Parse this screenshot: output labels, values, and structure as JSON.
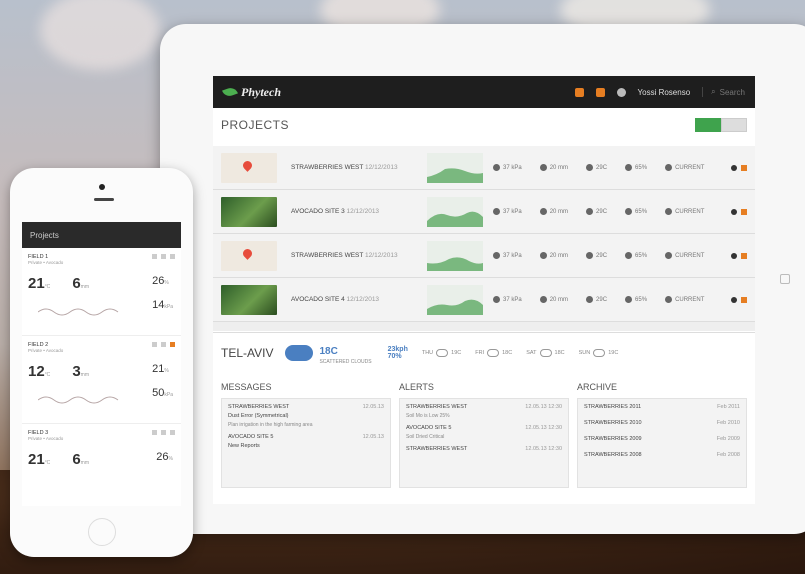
{
  "app": {
    "brand": "Phytech"
  },
  "topbar": {
    "user": "Yossi Rosenso",
    "search_placeholder": "Search"
  },
  "projects": {
    "title": "PROJECTS",
    "rows": [
      {
        "name": "STRAWBERRIES WEST",
        "sub": "12/12/2013",
        "thumb": "map",
        "metrics": [
          "37 kPa",
          "20 mm",
          "29C",
          "65%",
          "CURRENT"
        ]
      },
      {
        "name": "AVOCADO SITE 3",
        "sub": "12/12/2013",
        "thumb": "photo",
        "metrics": [
          "37 kPa",
          "20 mm",
          "29C",
          "65%",
          "CURRENT"
        ]
      },
      {
        "name": "STRAWBERRIES WEST",
        "sub": "12/12/2013",
        "thumb": "map",
        "metrics": [
          "37 kPa",
          "20 mm",
          "29C",
          "65%",
          "CURRENT"
        ]
      },
      {
        "name": "AVOCADO SITE 4",
        "sub": "12/12/2013",
        "thumb": "photo",
        "metrics": [
          "37 kPa",
          "20 mm",
          "29C",
          "65%",
          "CURRENT"
        ]
      }
    ]
  },
  "weather": {
    "city": "TEL-AVIV",
    "temp": "18C",
    "desc": "SCATTERED CLOUDS",
    "wind": "23kph",
    "humidity": "70%",
    "forecast": [
      {
        "day": "THU",
        "temp": "19C"
      },
      {
        "day": "FRI",
        "temp": "18C"
      },
      {
        "day": "SAT",
        "temp": "18C"
      },
      {
        "day": "SUN",
        "temp": "19C"
      }
    ]
  },
  "messages": {
    "title": "MESSAGES",
    "items": [
      {
        "head": "STRAWBERRIES WEST",
        "sub": "Dust Error (Symmetrical)",
        "time": "12.05.13",
        "body": "Plan irrigation in the high farming area"
      },
      {
        "head": "AVOCADO SITE 5",
        "sub": "New Reports",
        "time": "12.05.13",
        "body": ""
      }
    ]
  },
  "alerts": {
    "title": "ALERTS",
    "items": [
      {
        "head": "STRAWBERRIES WEST",
        "time": "12.05.13 12:30",
        "body": "Soil Mo is Low 25%"
      },
      {
        "head": "AVOCADO SITE 5",
        "time": "12.05.13 12:30",
        "body": "Soil Dried Critical"
      },
      {
        "head": "STRAWBERRIES WEST",
        "time": "12.05.13 12:30",
        "body": ""
      }
    ]
  },
  "archive": {
    "title": "ARCHIVE",
    "items": [
      {
        "name": "STRAWBERRIES 2011",
        "date": "Feb 2011"
      },
      {
        "name": "STRAWBERRIES 2010",
        "date": "Feb 2010"
      },
      {
        "name": "STRAWBERRIES 2009",
        "date": "Feb 2009"
      },
      {
        "name": "STRAWBERRIES 2008",
        "date": "Feb 2008"
      }
    ]
  },
  "phone": {
    "header": "Projects",
    "fields": [
      {
        "title": "FIELD 1",
        "sub": "Private • Avocado",
        "v1": "21",
        "u1": "°C",
        "v2": "6",
        "u2": "mm",
        "r1": "26",
        "r1u": "%",
        "r2": "14",
        "r2u": "kPa"
      },
      {
        "title": "FIELD 2",
        "sub": "Private • Avocado",
        "v1": "12",
        "u1": "°C",
        "v2": "3",
        "u2": "mm",
        "r1": "21",
        "r1u": "%",
        "r2": "50",
        "r2u": "kPa"
      },
      {
        "title": "FIELD 3",
        "sub": "Private • Avocado",
        "v1": "21",
        "u1": "°C",
        "v2": "6",
        "u2": "mm",
        "r1": "26",
        "r1u": "%",
        "r2": "",
        "r2u": ""
      }
    ]
  },
  "colors": {
    "accent_green": "#3fa34d",
    "accent_orange": "#e67e22",
    "weather_blue": "#4a7fc1"
  }
}
